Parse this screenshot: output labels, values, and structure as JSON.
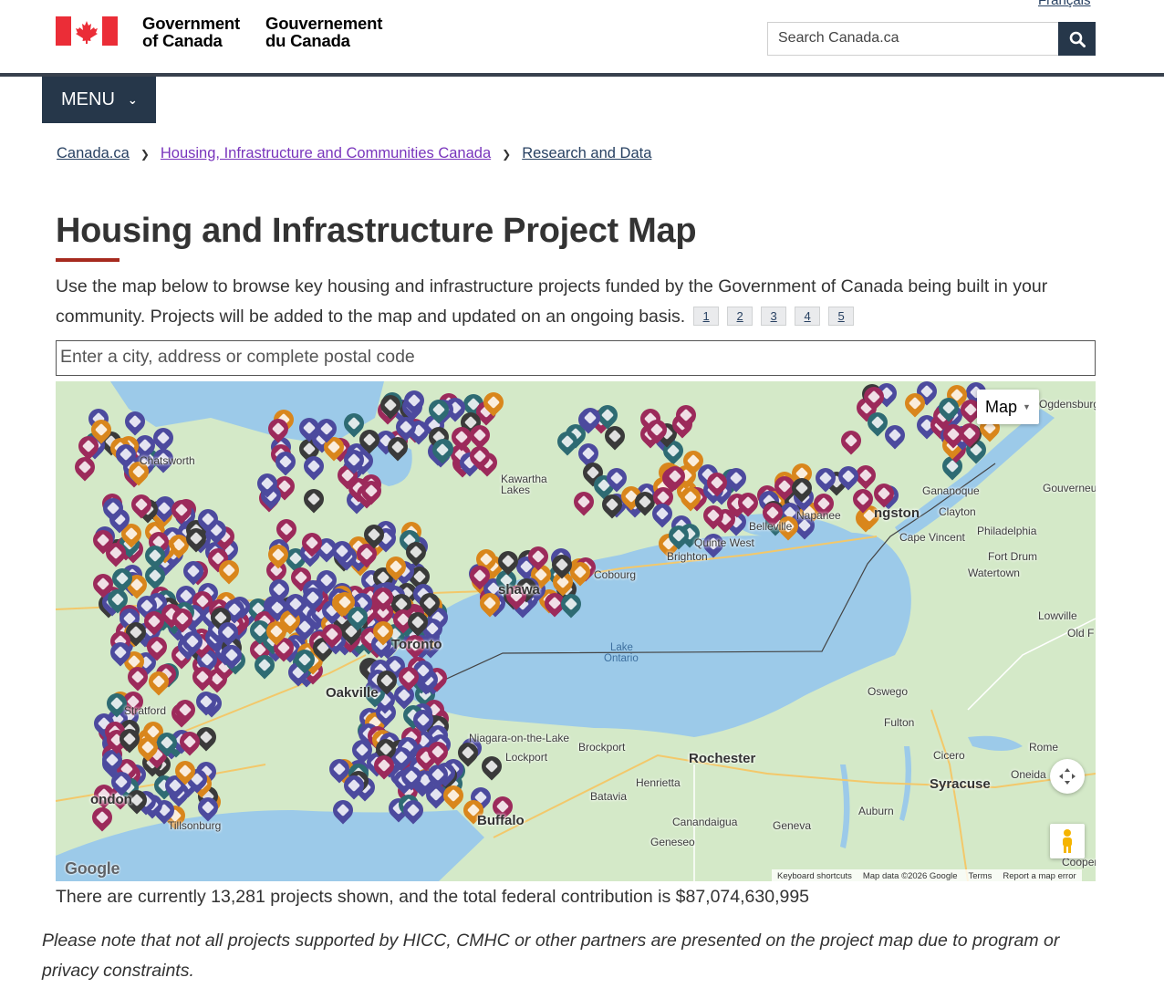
{
  "header": {
    "lang_link": "Français",
    "gov_en_line1": "Government",
    "gov_en_line2": "of Canada",
    "gov_fr_line1": "Gouvernement",
    "gov_fr_line2": "du Canada",
    "search_placeholder": "Search Canada.ca",
    "menu_label": "MENU"
  },
  "breadcrumb": [
    {
      "label": "Canada.ca"
    },
    {
      "label": "Housing, Infrastructure and Communities Canada"
    },
    {
      "label": "Research and Data"
    }
  ],
  "page_title": "Housing and Infrastructure Project Map",
  "intro_text": "Use the map below to browse key housing and infrastructure projects funded by the Government of Canada being built in your community. Projects will be added to the map and updated on an ongoing basis.",
  "footnotes": [
    "1",
    "2",
    "3",
    "4",
    "5"
  ],
  "address_search_placeholder": "Enter a city, address or complete postal code",
  "map": {
    "type_button": "Map",
    "labels": {
      "toronto": "Toronto",
      "oakville": "Oakville",
      "rochester": "Rochester",
      "buffalo": "Buffalo",
      "syracuse": "Syracuse",
      "kingston": "ngston",
      "oshawa": "shawa",
      "lake": "Lake",
      "ontario": "Ontario",
      "cobourg": "Cobourg",
      "brighton": "Brighton",
      "quinte_west": "Quinte West",
      "belleville": "Belleville",
      "napanee": "Napanee",
      "gananoque": "Gananoque",
      "clayton": "Clayton",
      "cape_vincent": "Cape Vincent",
      "philadelphia": "Philadelphia",
      "fort_drum": "Fort Drum",
      "watertown": "Watertown",
      "lowville": "Lowville",
      "oswego": "Oswego",
      "fulton": "Fulton",
      "rome": "Rome",
      "cicero": "Cicero",
      "oneida": "Oneida",
      "auburn": "Auburn",
      "geneva": "Geneva",
      "canandaigua": "Canandaigua",
      "geneseo": "Geneseo",
      "batavia": "Batavia",
      "henrietta": "Henrietta",
      "brockport": "Brockport",
      "lockport": "Lockport",
      "niagara_otl": "Niagara-on-the-Lake",
      "london": "ondon",
      "stratford": "Stratford",
      "tillsonburg": "Tillsonburg",
      "chatsworth": "Chatsworth",
      "kawartha": "Kawartha",
      "kawartha2": "Lakes",
      "gouverneur": "Gouverneur",
      "ogdensburg": "Ogdensburg",
      "cooper": "Cooper",
      "old_f": "Old F"
    },
    "attribution": {
      "shortcuts": "Keyboard shortcuts",
      "data": "Map data ©2026 Google",
      "terms": "Terms",
      "report": "Report a map error"
    },
    "google": "Google"
  },
  "summary": "There are currently 13,281 projects shown, and the total federal contribution is $87,074,630,995",
  "note": "Please note that not all projects supported by HICC, CMHC or other partners are presented on the project map due to program or privacy constraints.",
  "colors": {
    "header_dark": "#26374a",
    "title_rule": "#a62a1e",
    "pin_purple": "#4c4a9e",
    "pin_maroon": "#9c2a5b",
    "pin_teal": "#2e6b73",
    "pin_orange": "#d9861c",
    "pin_dark": "#3a3a3a",
    "water": "#9ccae9",
    "land": "#cfe6c2"
  }
}
